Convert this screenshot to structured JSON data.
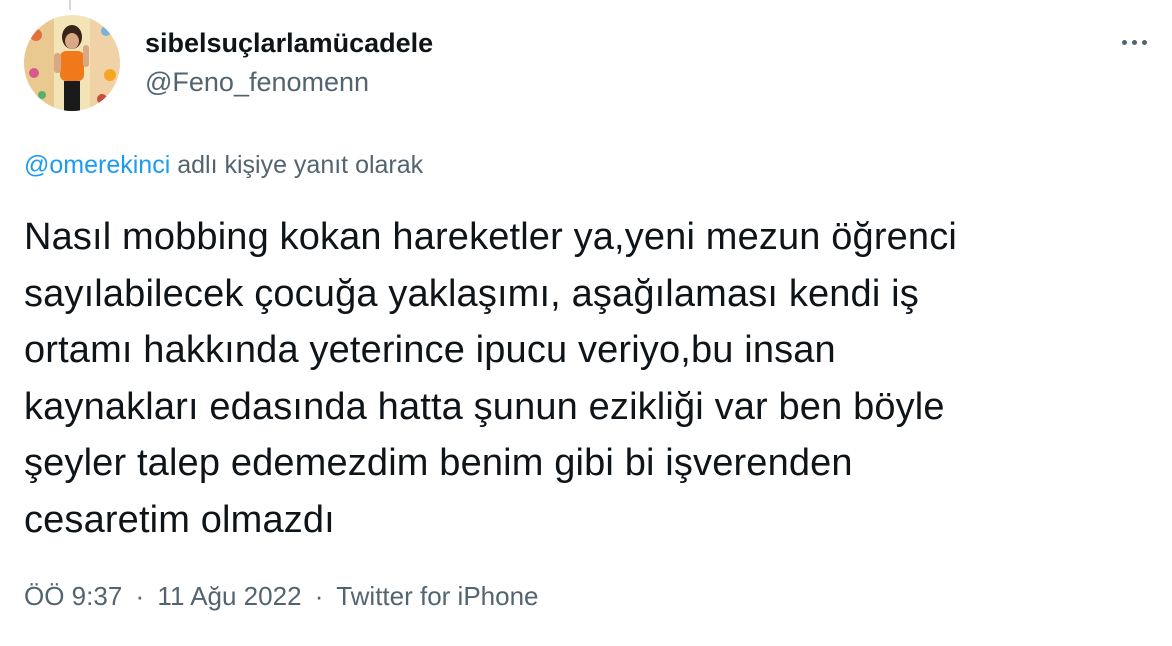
{
  "author": {
    "display_name": "sibelsuçlarlamücadele",
    "handle": "@Feno_fenomenn"
  },
  "more_menu": {
    "icon": "more-horizontal-icon"
  },
  "reply_context": {
    "mention": "@omerekinci",
    "suffix": "adlı kişiye yanıt olarak"
  },
  "tweet": {
    "text": "Nasıl mobbing kokan hareketler ya,yeni mezun öğrenci\nsayılabilecek çocuğa yaklaşımı, aşağılaması kendi iş\nortamı hakkında yeterince ipucu veriyo,bu insan\nkaynakları edasında hatta şunun ezikliği var ben böyle\nşeyler talep edemezdim benim gibi bi işverenden\ncesaretim olmazdı"
  },
  "meta": {
    "time": "ÖÖ 9:37",
    "separator": "·",
    "date": "11 Ağu 2022",
    "source": "Twitter for iPhone"
  },
  "colors": {
    "text_primary": "#0f1419",
    "text_secondary": "#536471",
    "link": "#1d9bf0"
  }
}
